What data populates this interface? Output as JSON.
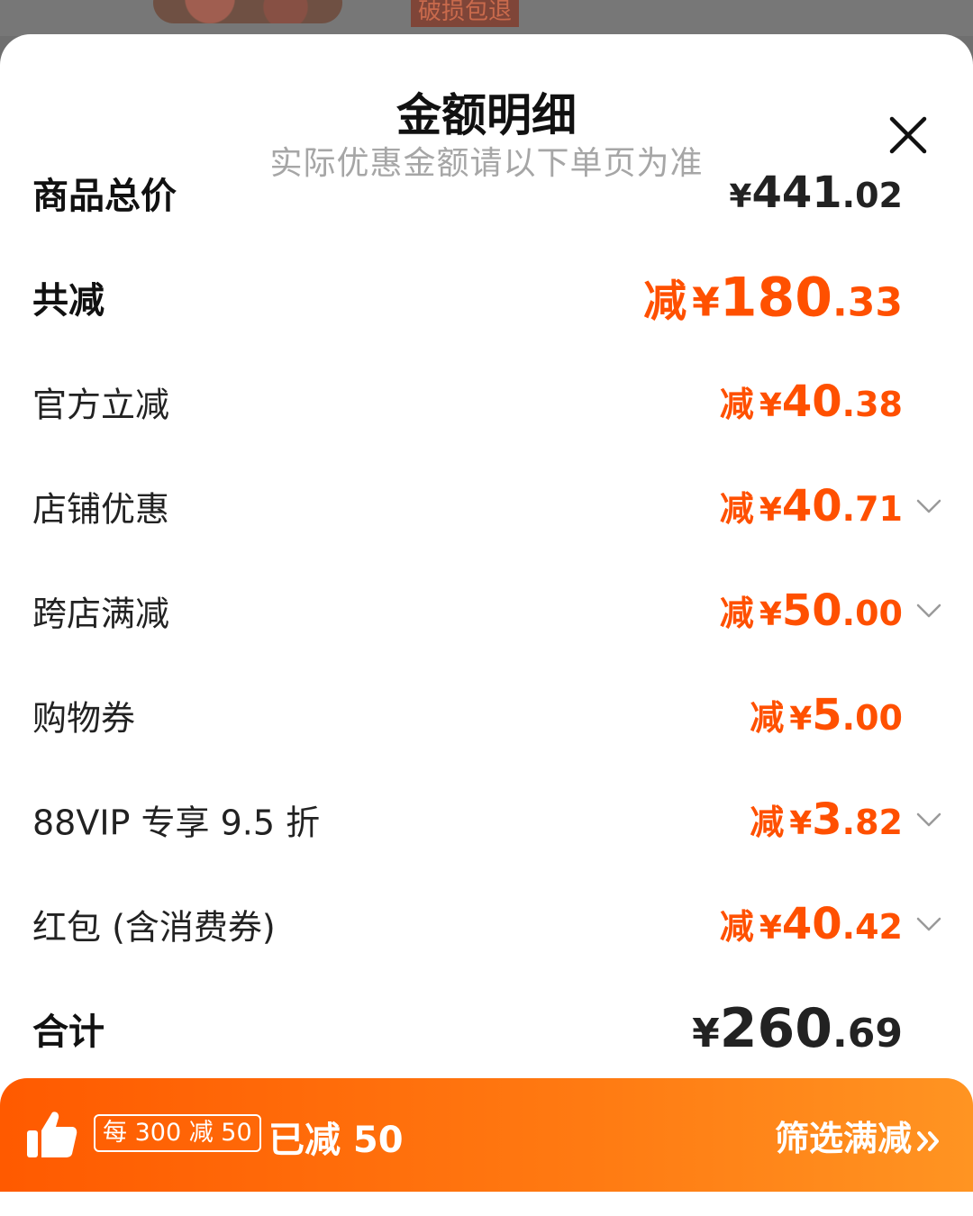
{
  "backdrop": {
    "tag": "破损包退"
  },
  "sheet": {
    "title": "金额明细",
    "subtitle": "实际优惠金额请以下单页为准"
  },
  "rows": [
    {
      "label": "商品总价",
      "prefix": "",
      "yen": "¥",
      "int": "441",
      "dec": ".02"
    },
    {
      "label": "共减",
      "prefix": "减",
      "yen": "¥",
      "int": "180",
      "dec": ".33"
    },
    {
      "label": "官方立减",
      "prefix": "减",
      "yen": "¥",
      "int": "40",
      "dec": ".38"
    },
    {
      "label": "店铺优惠",
      "prefix": "减",
      "yen": "¥",
      "int": "40",
      "dec": ".71"
    },
    {
      "label": "跨店满减",
      "prefix": "减",
      "yen": "¥",
      "int": "50",
      "dec": ".00"
    },
    {
      "label": "购物券",
      "prefix": "减",
      "yen": "¥",
      "int": "5",
      "dec": ".00"
    },
    {
      "label": "88VIP 专享 9.5 折",
      "prefix": "减",
      "yen": "¥",
      "int": "3",
      "dec": ".82"
    },
    {
      "label": "红包 (含消费券)",
      "prefix": "减",
      "yen": "¥",
      "int": "40",
      "dec": ".42"
    },
    {
      "label": "合计",
      "prefix": "",
      "yen": "¥",
      "int": "260",
      "dec": ".69"
    }
  ],
  "promo": {
    "tag": "每 300 减 50",
    "done": "已减 50",
    "filter_label": "筛选满减"
  },
  "colors": {
    "accent": "#ff5000",
    "bar_start": "#ff5a00",
    "bar_end": "#ff9422"
  }
}
